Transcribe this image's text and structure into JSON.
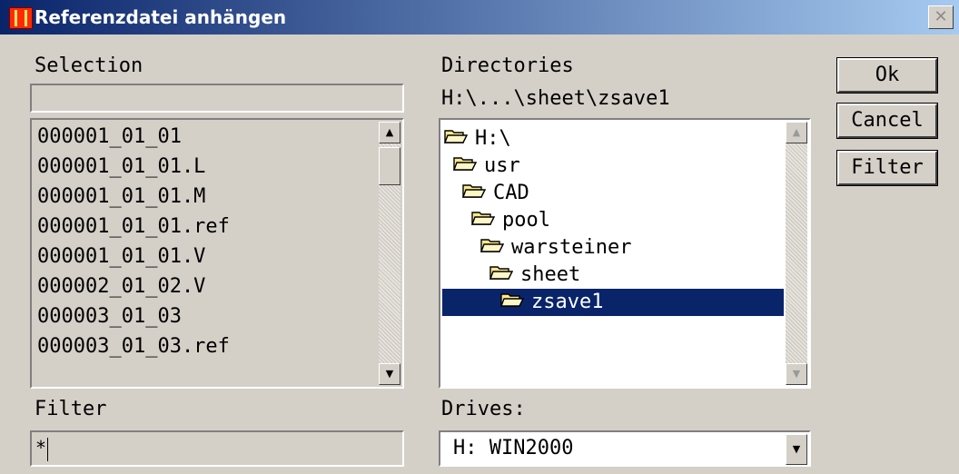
{
  "window": {
    "title": "Referenzdatei anhängen",
    "close_glyph": "✕"
  },
  "selection": {
    "label": "Selection",
    "value": ""
  },
  "files": [
    "000001_01_01",
    "000001_01_01.L",
    "000001_01_01.M",
    "000001_01_01.ref",
    "000001_01_01.V",
    "000002_01_02.V",
    "000003_01_03",
    "000003_01_03.ref"
  ],
  "directories": {
    "label": "Directories",
    "path": "H:\\...\\sheet\\zsave1",
    "items": [
      {
        "name": "H:\\",
        "selected": false
      },
      {
        "name": "usr",
        "selected": false
      },
      {
        "name": "CAD",
        "selected": false
      },
      {
        "name": "pool",
        "selected": false
      },
      {
        "name": "warsteiner",
        "selected": false
      },
      {
        "name": "sheet",
        "selected": false
      },
      {
        "name": "zsave1",
        "selected": true
      }
    ]
  },
  "filter": {
    "label": "Filter",
    "value": "*"
  },
  "drives": {
    "label": "Drives:",
    "value": "H: WIN2000"
  },
  "buttons": {
    "ok": "Ok",
    "cancel": "Cancel",
    "filter": "Filter"
  },
  "colors": {
    "selection_bg": "#0a246a",
    "titlebar_start": "#0a246a",
    "titlebar_end": "#a6caf0",
    "folder": "#ffe88a"
  }
}
